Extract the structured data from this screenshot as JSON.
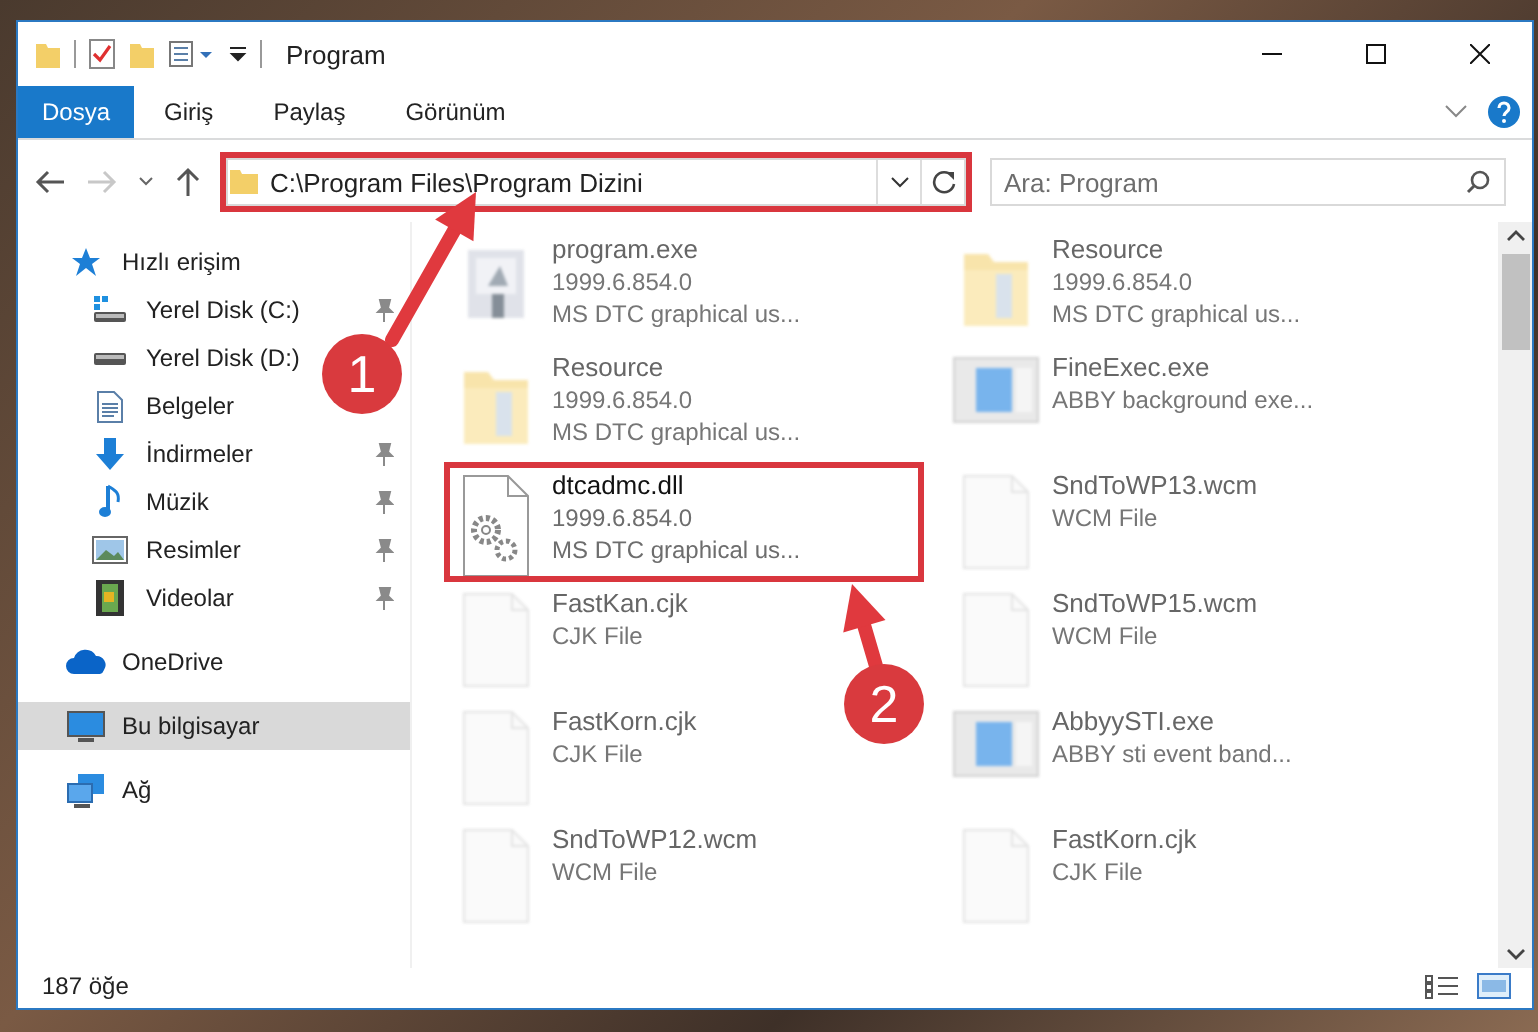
{
  "window": {
    "title": "Program"
  },
  "ribbon": {
    "tabs": [
      {
        "label": "Dosya",
        "selected": true
      },
      {
        "label": "Giriş",
        "selected": false
      },
      {
        "label": "Paylaş",
        "selected": false
      },
      {
        "label": "Görünüm",
        "selected": false
      }
    ]
  },
  "address": {
    "path": "C:\\Program Files\\Program Dizini",
    "highlighted": true
  },
  "search": {
    "placeholder": "Ara: Program"
  },
  "sidebar": {
    "items": [
      {
        "label": "Hızlı erişim",
        "kind": "star",
        "selected": false,
        "pinned": false,
        "children": [
          {
            "label": "Yerel Disk (C:)",
            "kind": "system-drive",
            "selected": false,
            "pinned": true
          },
          {
            "label": "Yerel Disk (D:)",
            "kind": "drive",
            "selected": false
          },
          {
            "label": "Belgeler",
            "kind": "document",
            "selected": false,
            "pinned": false
          },
          {
            "label": "İndirmeler",
            "kind": "download",
            "selected": false,
            "pinned": true
          },
          {
            "label": "Müzik",
            "kind": "music",
            "selected": false,
            "pinned": true
          },
          {
            "label": "Resimler",
            "kind": "picture",
            "selected": false,
            "pinned": true
          },
          {
            "label": "Videolar",
            "kind": "video",
            "selected": false,
            "pinned": true
          }
        ]
      },
      {
        "label": "OneDrive",
        "kind": "cloud",
        "selected": false,
        "pinned": false
      },
      {
        "label": "Bu bilgisayar",
        "kind": "computer",
        "selected": true,
        "pinned": false
      },
      {
        "label": "Ağ",
        "kind": "network",
        "selected": false,
        "pinned": false
      }
    ]
  },
  "files": [
    {
      "name": "program.exe",
      "lines": [
        "1999.6.854.0",
        "MS DTC graphical us..."
      ],
      "kind": "installer",
      "blurred": true,
      "highlighted": false
    },
    {
      "name": "Resource",
      "lines": [
        "1999.6.854.0",
        "MS DTC graphical us..."
      ],
      "kind": "folder",
      "blurred": true,
      "highlighted": false
    },
    {
      "name": "Resource",
      "lines": [
        "1999.6.854.0",
        "MS DTC graphical us..."
      ],
      "kind": "folder",
      "blurred": true,
      "highlighted": false
    },
    {
      "name": "FineExec.exe",
      "lines": [
        "ABBY background exe..."
      ],
      "kind": "window-app",
      "blurred": true,
      "highlighted": false
    },
    {
      "name": "dtcadmc.dll",
      "lines": [
        "1999.6.854.0",
        "MS DTC graphical us..."
      ],
      "kind": "dll",
      "blurred": false,
      "highlighted": true
    },
    {
      "name": "SndToWP13.wcm",
      "lines": [
        "WCM File"
      ],
      "kind": "blank",
      "blurred": true,
      "highlighted": false
    },
    {
      "name": "FastKan.cjk",
      "lines": [
        "CJK File"
      ],
      "kind": "blank",
      "blurred": true,
      "highlighted": false
    },
    {
      "name": "SndToWP15.wcm",
      "lines": [
        "WCM File"
      ],
      "kind": "blank",
      "blurred": true,
      "highlighted": false
    },
    {
      "name": "FastKorn.cjk",
      "lines": [
        "CJK File"
      ],
      "kind": "blank",
      "blurred": true,
      "highlighted": false
    },
    {
      "name": "AbbyySTI.exe",
      "lines": [
        "ABBY sti event band..."
      ],
      "kind": "window-app",
      "blurred": true,
      "highlighted": false
    },
    {
      "name": "SndToWP12.wcm",
      "lines": [
        "WCM File"
      ],
      "kind": "blank",
      "blurred": true,
      "highlighted": false
    },
    {
      "name": "FastKorn.cjk",
      "lines": [
        "CJK File"
      ],
      "kind": "blank",
      "blurred": true,
      "highlighted": false
    }
  ],
  "status_bar": {
    "item_count": "187 öğe"
  },
  "annotations": [
    {
      "label": "1"
    },
    {
      "label": "2"
    }
  ]
}
